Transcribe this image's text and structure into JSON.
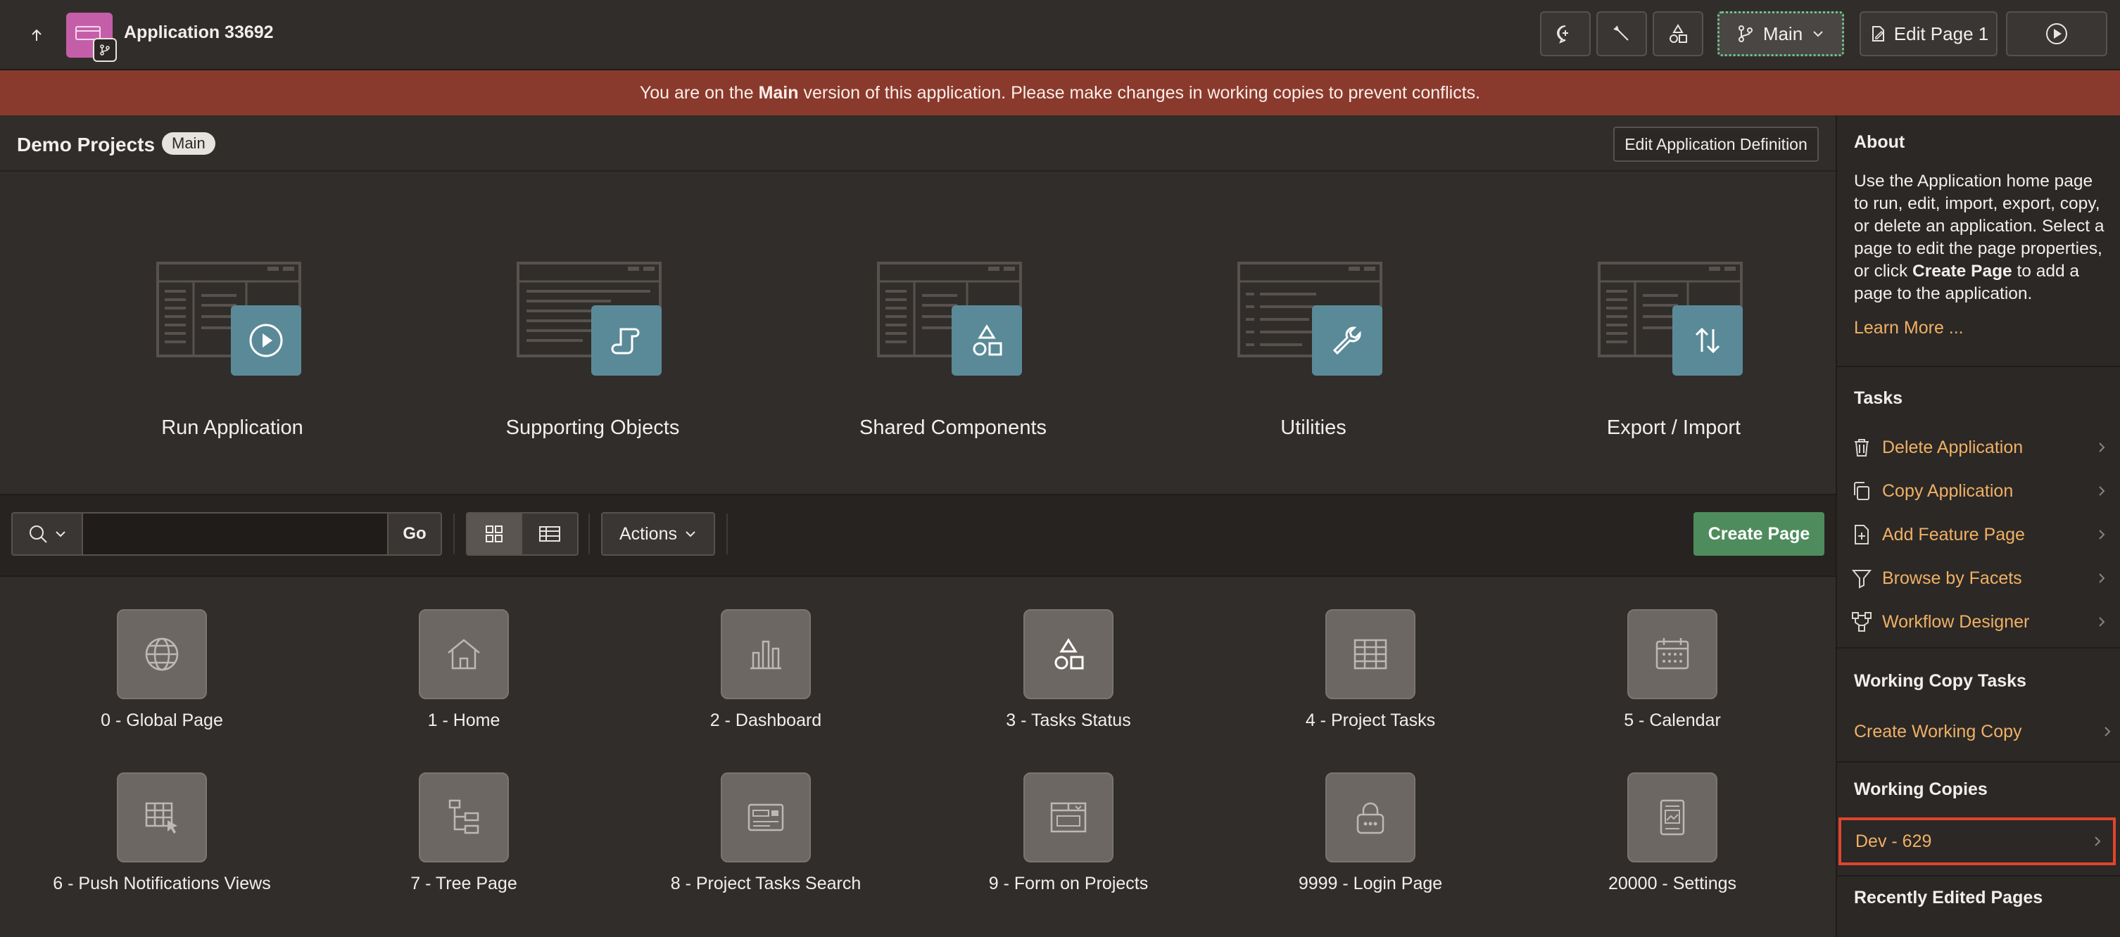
{
  "header": {
    "app_title": "Application 33692",
    "branch_label": "Main",
    "edit_page_label": "Edit Page 1"
  },
  "banner": {
    "prefix": "You are on the ",
    "branch": "Main",
    "suffix": " version of this application. Please make changes in working copies to prevent conflicts."
  },
  "app": {
    "name": "Demo Projects",
    "branch_pill": "Main",
    "edit_definition_label": "Edit Application Definition"
  },
  "tiles": [
    {
      "label": "Run Application",
      "icon": "play-icon"
    },
    {
      "label": "Supporting Objects",
      "icon": "scroll-icon"
    },
    {
      "label": "Shared Components",
      "icon": "shapes-icon"
    },
    {
      "label": "Utilities",
      "icon": "wrench-icon"
    },
    {
      "label": "Export / Import",
      "icon": "up-down-arrows-icon"
    }
  ],
  "toolbar": {
    "search_placeholder": "",
    "go_label": "Go",
    "actions_label": "Actions",
    "create_page_label": "Create Page"
  },
  "pages": [
    {
      "name": "0 - Global Page",
      "icon": "globe-icon"
    },
    {
      "name": "1 - Home",
      "icon": "home-icon"
    },
    {
      "name": "2 - Dashboard",
      "icon": "bar-chart-icon"
    },
    {
      "name": "3 - Tasks Status",
      "icon": "shapes-icon"
    },
    {
      "name": "4 - Project Tasks",
      "icon": "table-icon"
    },
    {
      "name": "5 - Calendar",
      "icon": "calendar-icon"
    },
    {
      "name": "6 - Push Notifications Views",
      "icon": "grid-cursor-icon"
    },
    {
      "name": "7 - Tree Page",
      "icon": "tree-icon"
    },
    {
      "name": "8 - Project Tasks Search",
      "icon": "search-form-icon"
    },
    {
      "name": "9 - Form on Projects",
      "icon": "form-icon"
    },
    {
      "name": "9999 - Login Page",
      "icon": "lock-icon"
    },
    {
      "name": "20000 - Settings",
      "icon": "settings-page-icon"
    }
  ],
  "sidebar": {
    "about_heading": "About",
    "about_text_1": "Use the Application home page to run, edit, import, export, copy, or delete an application. Select a page to edit the page properties, or click ",
    "about_bold": "Create Page",
    "about_text_2": " to add a page to the application.",
    "learn_more": "Learn More ...",
    "tasks_heading": "Tasks",
    "tasks": [
      {
        "label": "Delete Application",
        "icon": "trash-icon"
      },
      {
        "label": "Copy Application",
        "icon": "copy-icon"
      },
      {
        "label": "Add Feature Page",
        "icon": "add-page-icon"
      },
      {
        "label": "Browse by Facets",
        "icon": "filter-icon"
      },
      {
        "label": "Workflow Designer",
        "icon": "workflow-icon"
      }
    ],
    "wc_tasks_heading": "Working Copy Tasks",
    "create_working_copy": "Create Working Copy",
    "working_copies_heading": "Working Copies",
    "working_copy": "Dev - 629",
    "recent_heading": "Recently Edited Pages"
  },
  "colors": {
    "background": "#312d2a",
    "banner": "#8a3a2c",
    "accent_link": "#f0b064",
    "primary_button": "#4f8c5d",
    "tile_icon": "#5a8a98",
    "highlight": "#e0452d"
  }
}
